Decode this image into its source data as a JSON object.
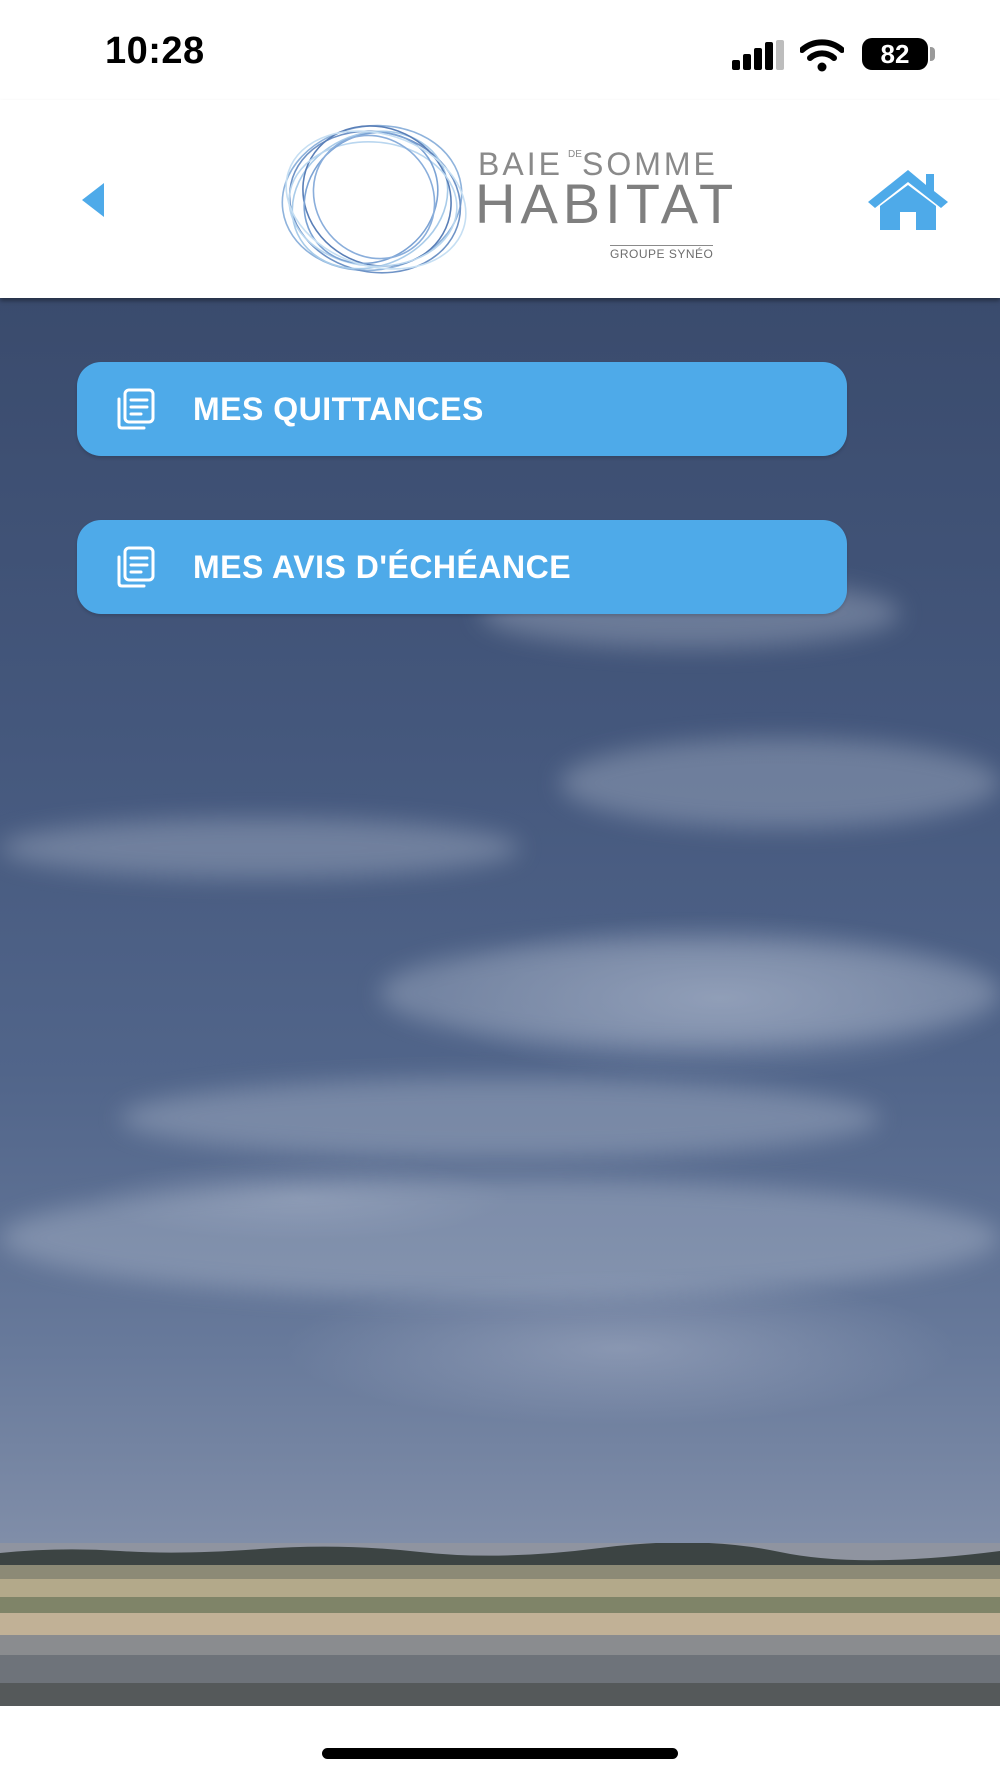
{
  "status_bar": {
    "time": "10:28",
    "battery": "82",
    "icons": [
      "signal-icon",
      "wifi-icon",
      "battery-icon"
    ]
  },
  "header": {
    "back_icon": "chevron-left-icon",
    "home_icon": "home-icon",
    "logo": {
      "line1a": "BAIE",
      "de": "DE",
      "line1b": "SOMME",
      "line2": "HABITAT",
      "line3": "GROUPE SYNÉO"
    }
  },
  "menu": {
    "items": [
      {
        "label": "MES QUITTANCES",
        "icon": "document-stack-icon"
      },
      {
        "label": "MES AVIS D'ÉCHÉANCE",
        "icon": "document-stack-icon"
      }
    ]
  },
  "colors": {
    "accent": "#4eaae9",
    "button_text": "#ffffff"
  }
}
